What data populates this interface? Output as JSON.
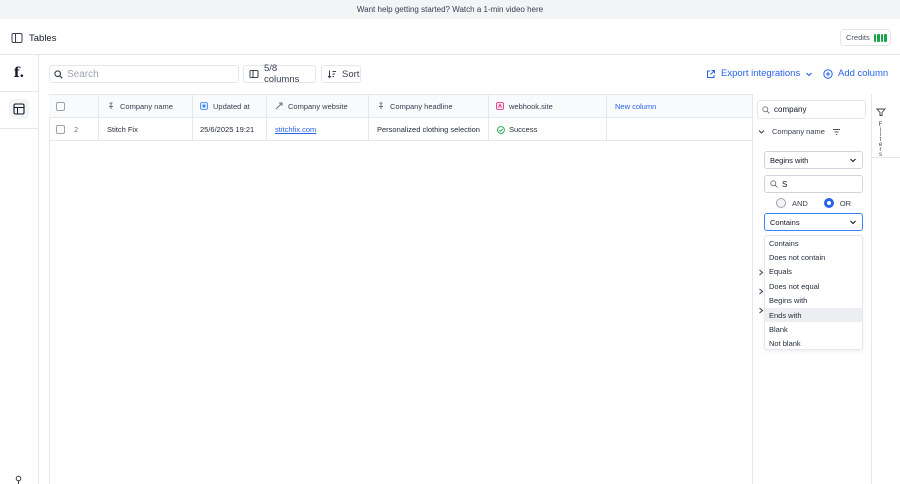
{
  "banner": {
    "text": "Want help getting started? Watch a 1-min video here"
  },
  "header": {
    "title": "Tables",
    "credits_label": "Credits"
  },
  "rail": {
    "logo": "f."
  },
  "toolbar": {
    "search_placeholder": "Search",
    "columns_label": "5/8 columns",
    "sort_label": "Sort",
    "export_label": "Export integrations",
    "add_column_label": "Add column"
  },
  "table": {
    "columns": [
      "Company name",
      "Updated at",
      "Company website",
      "Company headline",
      "webhook.site",
      "New column"
    ],
    "rows": [
      {
        "index": "2",
        "company_name": "Stitch Fix",
        "updated_at": "25/6/2025 19:21",
        "website": "stitchfix.com",
        "headline": "Personalized clothing selection",
        "webhook": "Success"
      }
    ]
  },
  "filter_panel": {
    "search_value": "company",
    "group_label": "Company name",
    "condition1": "Begins with",
    "value1": "S",
    "and_label": "AND",
    "or_label": "OR",
    "logic_selected": "OR",
    "condition2": "Contains",
    "options": [
      "Contains",
      "Does not contain",
      "Equals",
      "Does not equal",
      "Begins with",
      "Ends with",
      "Blank",
      "Not blank"
    ],
    "highlighted_option": "Ends with",
    "side_label": "Filters"
  },
  "colors": {
    "accent": "#2563eb",
    "success": "#16a34a",
    "highlight": "#eceef1"
  }
}
